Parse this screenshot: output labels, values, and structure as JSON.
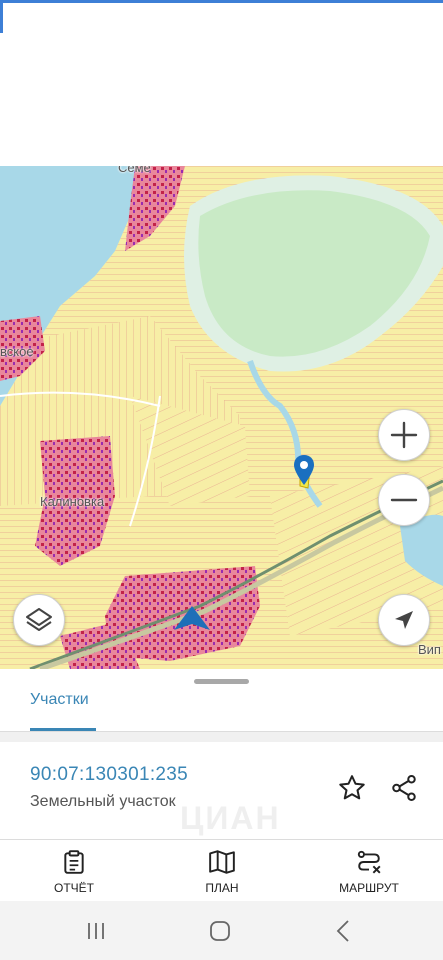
{
  "map": {
    "places": [
      "Семе",
      "вское",
      "Калиновка",
      "Вип"
    ],
    "zoom_in_label": "+",
    "zoom_out_label": "−"
  },
  "tabs": {
    "parcels": "Участки"
  },
  "parcel": {
    "cadastral_number": "90:07:130301:235",
    "type": "Земельный участок",
    "watermark": "ЦИАН"
  },
  "actions": {
    "report": "ОТЧЁТ",
    "plan": "ПЛАН",
    "route": "МАРШРУТ"
  },
  "colors": {
    "accent": "#3a86b5",
    "water": "#a8d8e8",
    "field": "#f7eea6",
    "parcel_line": "#e8a090",
    "settlement": "#d23a5a"
  },
  "icons": [
    "layers-icon",
    "location-arrow-icon",
    "map-pin-icon",
    "star-icon",
    "share-icon",
    "report-icon",
    "plan-icon",
    "route-icon"
  ]
}
